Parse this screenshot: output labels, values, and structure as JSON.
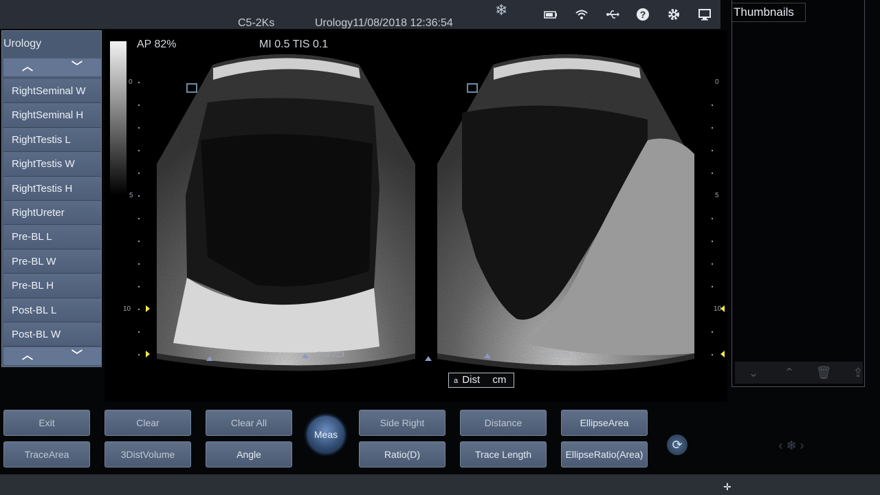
{
  "header": {
    "probe": "C5-2Ks",
    "preset_datetime": "Urology11/08/2018 12:36:54",
    "icons": [
      "freeze-icon",
      "battery-icon",
      "wifi-icon",
      "usb-icon",
      "help-icon",
      "settings-icon",
      "monitor-icon"
    ]
  },
  "image_info": {
    "ap": "AP  82%",
    "mi_tis": "MI 0.5 TIS 0.1",
    "depth_left": [
      "0",
      "5",
      "10"
    ],
    "depth_right": [
      "0",
      "5",
      "10"
    ],
    "left_scale": "703/223",
    "right_scale": "125/125"
  },
  "menu": {
    "title": "Urology",
    "items": [
      "RightSeminal W",
      "RightSeminal H",
      "RightTestis L",
      "RightTestis W",
      "RightTestis H",
      "RightUreter",
      "Pre-BL L",
      "Pre-BL W",
      "Pre-BL H",
      "Post-BL L",
      "Post-BL W"
    ]
  },
  "thumbnails": {
    "title": "Thumbnails"
  },
  "measurement": {
    "dist_label": "Dist",
    "dist_unit": "cm",
    "marker": "a"
  },
  "buttons": {
    "row1": [
      "Exit",
      "Clear",
      "Clear All",
      "Side  Right",
      "Distance",
      "EllipseArea"
    ],
    "row2": [
      "TraceArea",
      "3DistVolume",
      "Angle",
      "Ratio(D)",
      "Trace Length",
      "EllipseRatio(Area)"
    ],
    "meas": "Meas"
  },
  "colors": {
    "accent": "#4b7fc0",
    "button": "#556680",
    "header": "#2a2f37"
  }
}
